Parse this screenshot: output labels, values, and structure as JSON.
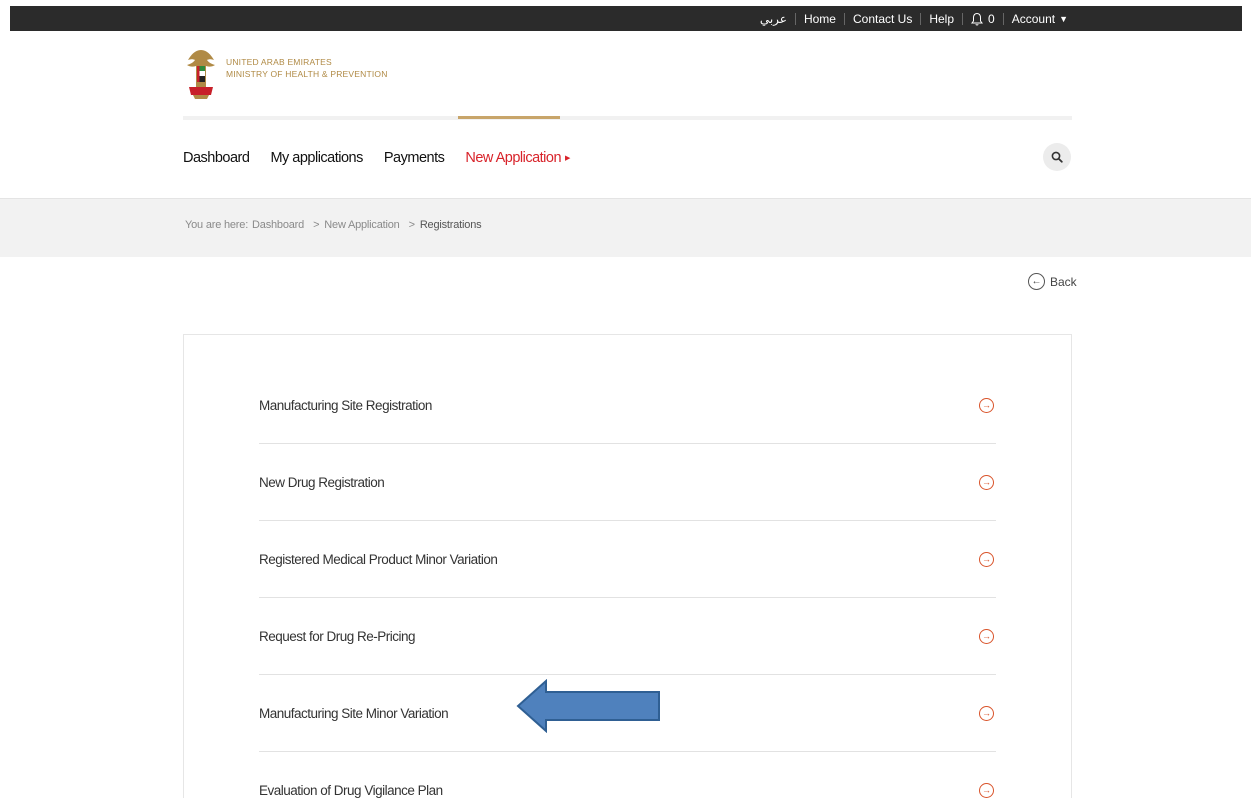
{
  "topbar": {
    "arabic": "عربي",
    "home": "Home",
    "contact": "Contact Us",
    "help": "Help",
    "notification_count": "0",
    "account": "Account"
  },
  "header": {
    "org_line1": "UNITED ARAB EMIRATES",
    "org_line2": "MINISTRY OF HEALTH & PREVENTION"
  },
  "nav": {
    "items": [
      "Dashboard",
      "My applications",
      "Payments"
    ],
    "active": "New Application"
  },
  "breadcrumb": {
    "prefix": "You are here:",
    "items": [
      "Dashboard",
      "New Application",
      "Registrations"
    ]
  },
  "back_label": "Back",
  "services": [
    "Manufacturing Site Registration",
    "New Drug Registration",
    "Registered Medical Product Minor Variation",
    "Request for Drug Re-Pricing",
    "Manufacturing Site Minor Variation",
    "Evaluation of Drug Vigilance Plan"
  ],
  "colors": {
    "topbar_bg": "#2b2b2b",
    "active_nav": "#d8232a",
    "gold_accent": "#c8a56a",
    "row_arrow": "#d9542b",
    "annotation_arrow": "#4f81bd"
  },
  "icons": {
    "notification": "bell-icon",
    "search": "search-icon",
    "back": "arrow-left-circle-icon",
    "row": "arrow-right-circle-icon"
  }
}
